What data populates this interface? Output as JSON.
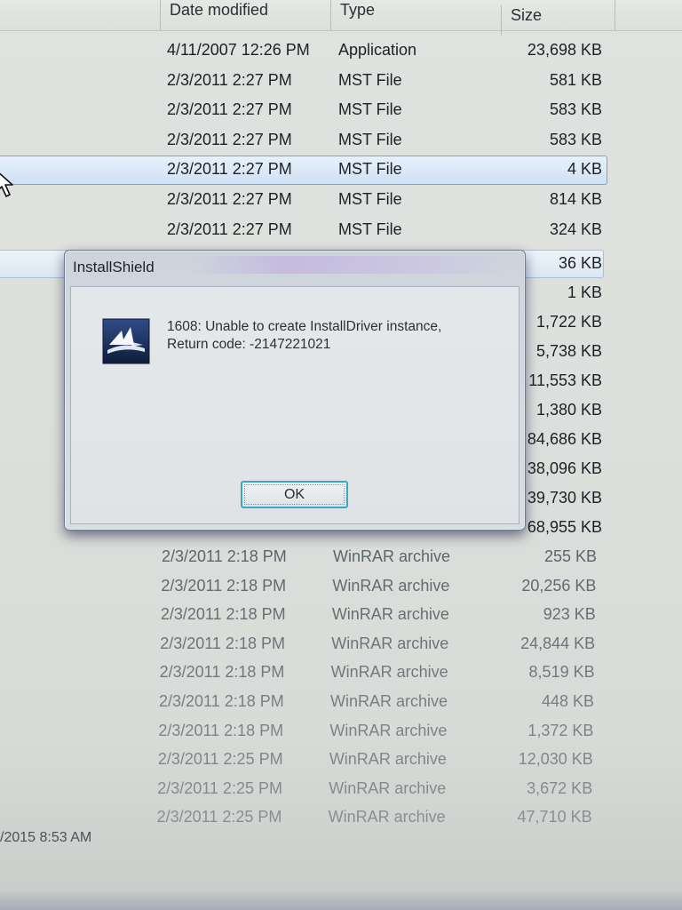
{
  "columns": {
    "date": "Date modified",
    "type": "Type",
    "size": "Size"
  },
  "rows_top": [
    {
      "date": "4/11/2007 12:26 PM",
      "type": "Application",
      "size": "23,698 KB"
    },
    {
      "date": "2/3/2011 2:27 PM",
      "type": "MST File",
      "size": "581 KB"
    },
    {
      "date": "2/3/2011 2:27 PM",
      "type": "MST File",
      "size": "583 KB"
    },
    {
      "date": "2/3/2011 2:27 PM",
      "type": "MST File",
      "size": "583 KB"
    },
    {
      "date": "2/3/2011 2:27 PM",
      "type": "MST File",
      "size": "4 KB",
      "state": "selected"
    },
    {
      "date": "2/3/2011 2:27 PM",
      "type": "MST File",
      "size": "814 KB"
    },
    {
      "date": "2/3/2011 2:27 PM",
      "type": "MST File",
      "size": "324 KB"
    }
  ],
  "rows_partial": [
    {
      "size": "36 KB",
      "state": "hovered"
    },
    {
      "size": "1 KB"
    },
    {
      "size": "1,722 KB"
    },
    {
      "size": "5,738 KB"
    },
    {
      "size": "11,553 KB"
    },
    {
      "size": "1,380 KB"
    },
    {
      "size": "84,686 KB"
    },
    {
      "size": "38,096 KB"
    },
    {
      "size": "39,730 KB"
    },
    {
      "size": "68,955 KB"
    }
  ],
  "rows_bottom": [
    {
      "date": "2/3/2011 2:18 PM",
      "type": "WinRAR archive",
      "size": "255 KB"
    },
    {
      "date": "2/3/2011 2:18 PM",
      "type": "WinRAR archive",
      "size": "20,256 KB"
    },
    {
      "date": "2/3/2011 2:18 PM",
      "type": "WinRAR archive",
      "size": "923 KB"
    },
    {
      "date": "2/3/2011 2:18 PM",
      "type": "WinRAR archive",
      "size": "24,844 KB"
    },
    {
      "date": "2/3/2011 2:18 PM",
      "type": "WinRAR archive",
      "size": "8,519 KB"
    },
    {
      "date": "2/3/2011 2:18 PM",
      "type": "WinRAR archive",
      "size": "448 KB"
    },
    {
      "date": "2/3/2011 2:18 PM",
      "type": "WinRAR archive",
      "size": "1,372 KB"
    },
    {
      "date": "2/3/2011 2:25 PM",
      "type": "WinRAR archive",
      "size": "12,030 KB"
    },
    {
      "date": "2/3/2011 2:25 PM",
      "type": "WinRAR archive",
      "size": "3,672 KB"
    },
    {
      "date": "2/3/2011 2:25 PM",
      "type": "WinRAR archive",
      "size": "47,710 KB"
    }
  ],
  "stray_date": "/2015 8:53 AM",
  "dialog": {
    "title": "InstallShield",
    "message_line1": "1608: Unable to create InstallDriver instance,",
    "message_line2": "Return code: -2147221021",
    "ok_label": "OK"
  },
  "colors": {
    "selection_border": "#7da2ce",
    "ok_focus_border": "#3aa6c8"
  },
  "icons": {
    "dialog": "installshield-logo-icon",
    "cursor": "mouse-pointer-icon"
  }
}
